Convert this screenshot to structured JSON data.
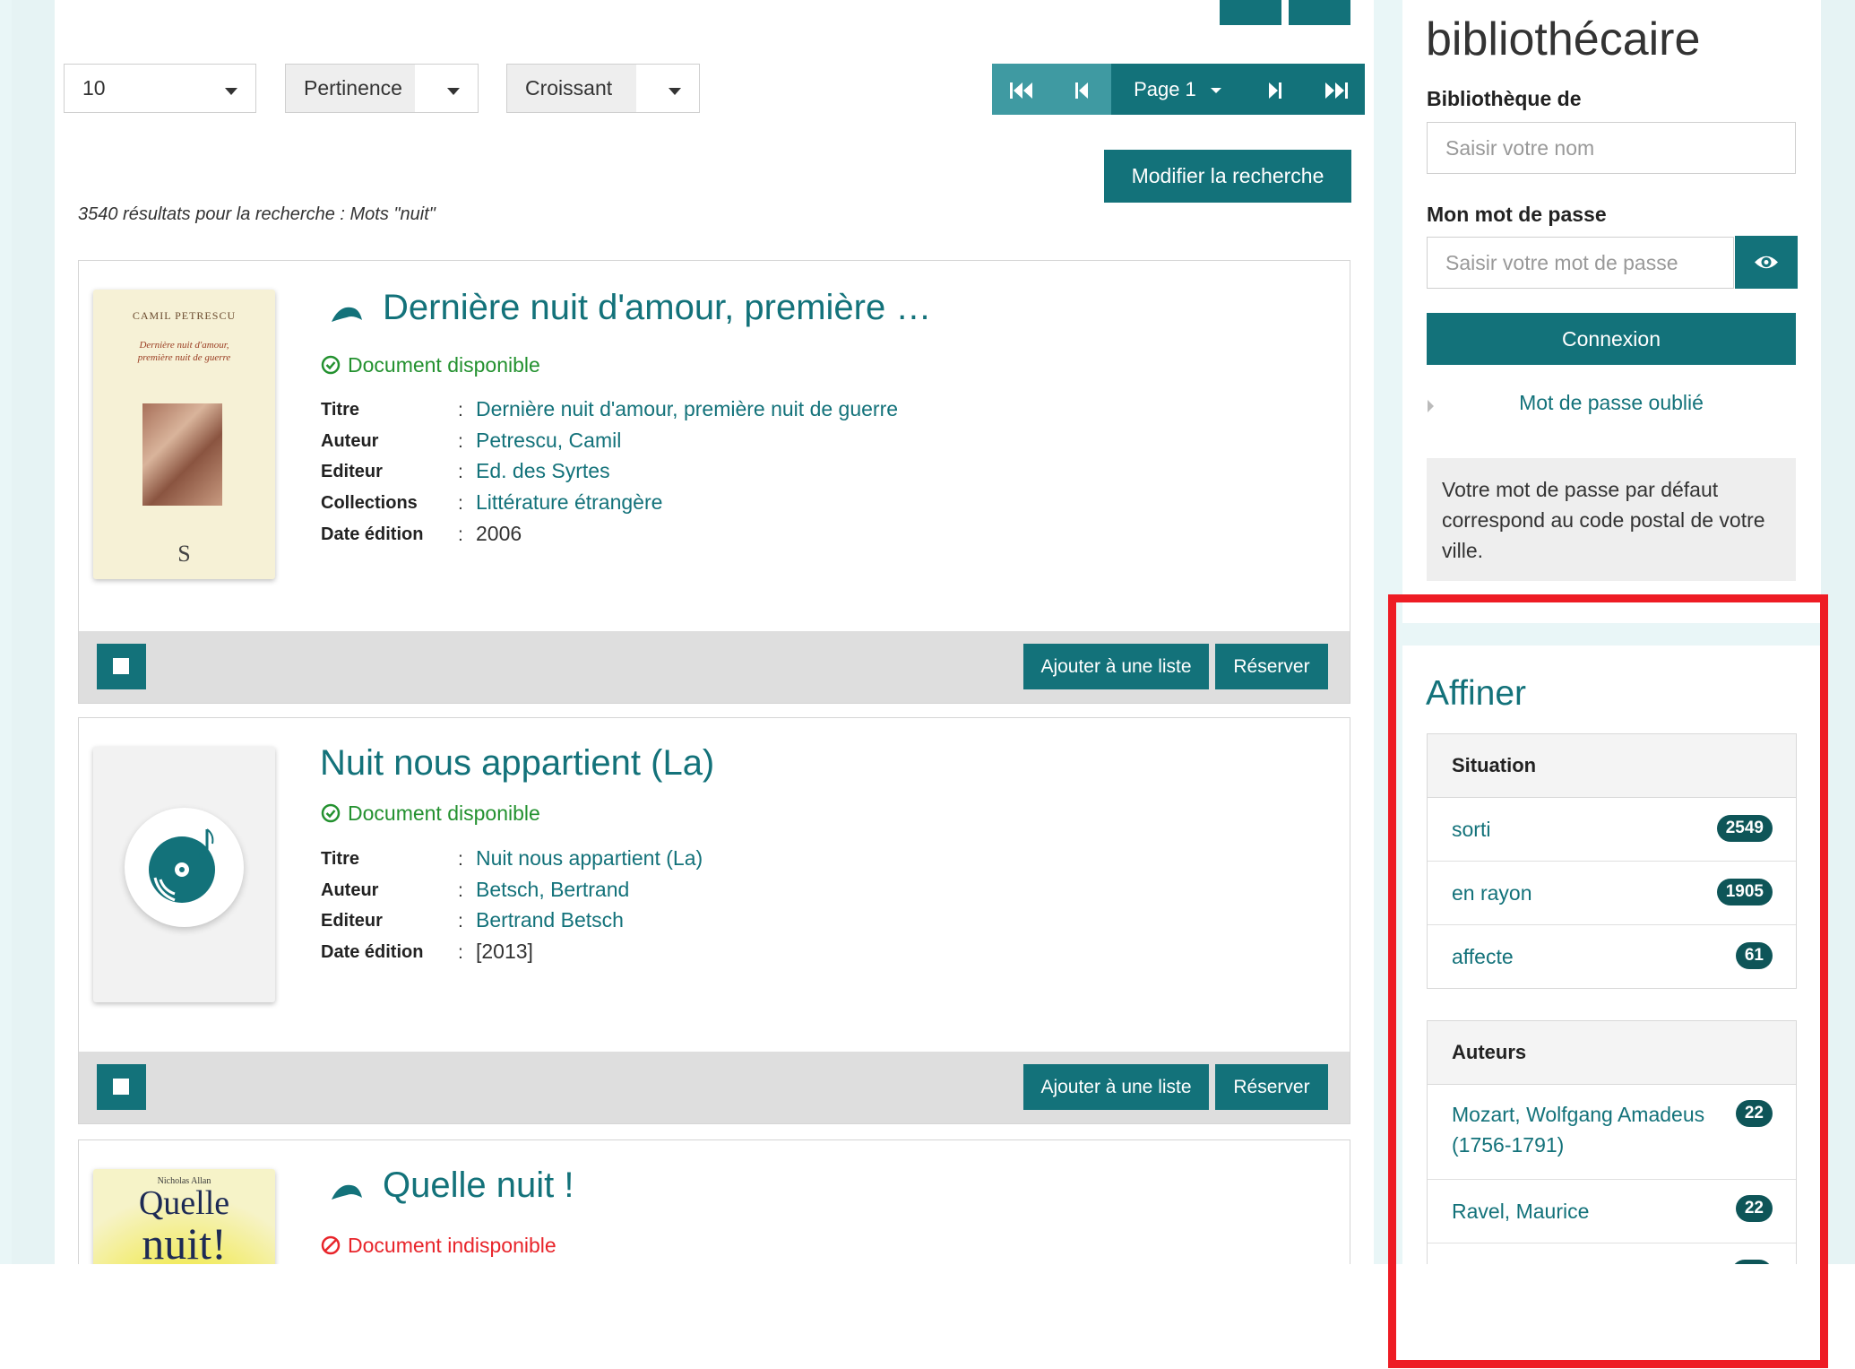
{
  "toolbar": {
    "per_page": "10",
    "sort_by": "Pertinence",
    "order": "Croissant",
    "pager_label": "Page 1",
    "modify_search": "Modifier la recherche"
  },
  "results_count": "3540 résultats pour la recherche : Mots \"nuit\"",
  "labels": {
    "titre": "Titre",
    "auteur": "Auteur",
    "editeur": "Editeur",
    "collections": "Collections",
    "date_edition": "Date édition",
    "colon": ":",
    "add_to_list": "Ajouter à une liste",
    "reserve": "Réserver"
  },
  "results": [
    {
      "heading": "Dernière nuit d'amour, première …",
      "availability": "Document disponible",
      "titre": "Dernière nuit d'amour, première nuit de guerre",
      "auteur": "Petrescu, Camil",
      "editeur": "Ed. des Syrtes",
      "collections": "Littérature étrangère",
      "date": "2006",
      "cover_author": "CAMIL PETRESCU",
      "cover_title_1": "Dernière nuit d'amour,",
      "cover_title_2": "première nuit de guerre",
      "cover_logo": "S"
    },
    {
      "heading": "Nuit nous appartient (La)",
      "availability": "Document disponible",
      "titre": "Nuit nous appartient (La)",
      "auteur": "Betsch, Bertrand",
      "editeur": "Bertrand Betsch",
      "date": "[2013]"
    },
    {
      "heading": "Quelle nuit !",
      "availability": "Document indisponible",
      "cover_author": "Nicholas Allan",
      "cover_title_1": "Quelle",
      "cover_title_2": "nuit!"
    }
  ],
  "sidebar": {
    "heading": "bibliothécaire",
    "library_label": "Bibliothèque de",
    "name_placeholder": "Saisir votre nom",
    "password_label": "Mon mot de passe",
    "password_placeholder": "Saisir votre mot de passe",
    "login_button": "Connexion",
    "forgot_link": "Mot de passe oublié",
    "note": "Votre mot de passe par défaut correspond au code postal de votre ville.",
    "refine_title": "Affiner",
    "facets": [
      {
        "title": "Situation",
        "items": [
          {
            "label": "sorti",
            "count": "2549"
          },
          {
            "label": "en rayon",
            "count": "1905"
          },
          {
            "label": "affecte",
            "count": "61"
          }
        ]
      },
      {
        "title": "Auteurs",
        "items": [
          {
            "label": "Mozart, Wolfgang Amadeus (1756-1791)",
            "count": "22"
          },
          {
            "label": "Ravel, Maurice",
            "count": "22"
          }
        ]
      }
    ]
  },
  "colors": {
    "teal": "#13727a",
    "teal_light": "#3f9aa2",
    "badge": "#0e5558",
    "available": "#23912f",
    "unavailable": "#e8242a",
    "highlight_box": "#ee1c24"
  }
}
